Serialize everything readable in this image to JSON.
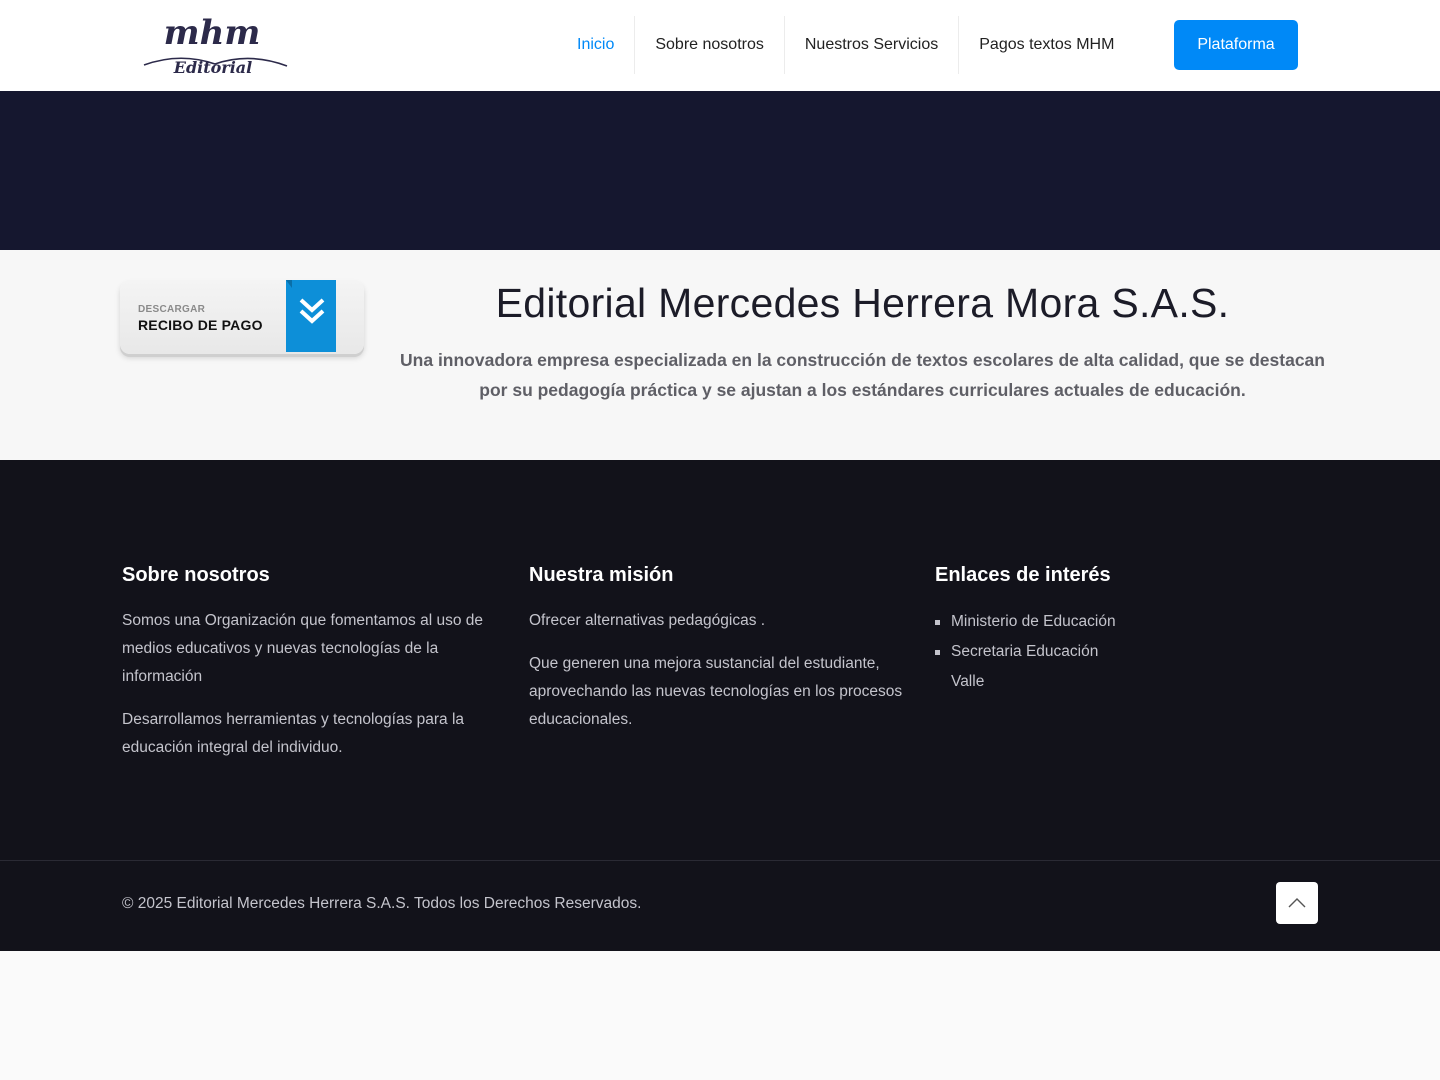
{
  "header": {
    "logo": {
      "mark": "mhm",
      "sub": "Editorial"
    },
    "nav": [
      {
        "label": "Inicio",
        "active": true
      },
      {
        "label": "Sobre nosotros",
        "active": false
      },
      {
        "label": "Nuestros Servicios",
        "active": false
      },
      {
        "label": "Pagos textos MHM",
        "active": false
      }
    ],
    "cta_label": "Plataforma"
  },
  "intro": {
    "recibo": {
      "small": "DESCARGAR",
      "big": "RECIBO DE PAGO",
      "icon": "double-chevron-down-icon"
    },
    "title": "Editorial Mercedes Herrera Mora S.A.S.",
    "subtitle": "Una innovadora empresa especializada en la construcción de textos escolares de alta calidad, que se destacan por su pedagogía práctica y se ajustan a los estándares curriculares actuales de educación."
  },
  "footer": {
    "about": {
      "heading": "Sobre nosotros",
      "paragraphs": [
        "Somos una Organización que fomentamos al uso de medios educativos y nuevas tecnologías de la información",
        "Desarrollamos herramientas y tecnologías para la educación integral del individuo."
      ]
    },
    "mission": {
      "heading": "Nuestra misión",
      "paragraphs": [
        "Ofrecer alternativas pedagógicas .",
        "Que generen una mejora sustancial del estudiante, aprovechando las nuevas tecnologías en los procesos educacionales."
      ]
    },
    "links": {
      "heading": "Enlaces de interés",
      "items": [
        "Ministerio de Educación",
        "Secretaria Educación Valle"
      ]
    },
    "copyright": "© 2025 Editorial Mercedes Herrera S.A.S. Todos los Derechos Reservados.",
    "to_top_icon": "chevron-up-icon"
  },
  "colors": {
    "accent": "#0089f7",
    "hero_bg": "#15172f",
    "footer_bg": "#12121a",
    "logo": "#2c2a4a"
  }
}
